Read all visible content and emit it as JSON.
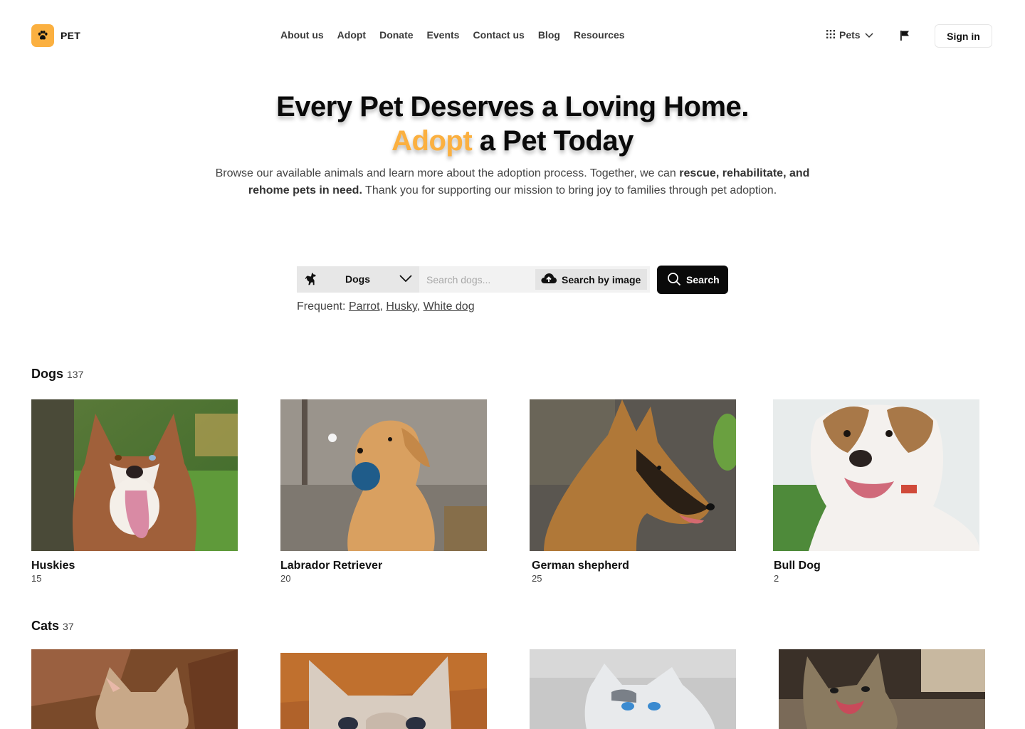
{
  "brand": {
    "name": "PET",
    "icon": "paw-icon",
    "accent_color": "#fbb040"
  },
  "nav": {
    "links": [
      "About us",
      "Adopt",
      "Donate",
      "Events",
      "Contact us",
      "Blog",
      "Resources"
    ],
    "pets_menu_label": "Pets",
    "sign_in_label": "Sign in"
  },
  "hero": {
    "title_line1": "Every Pet Deserves a Loving Home.",
    "title_accent": "Adopt",
    "title_line2_rest": " a Pet Today",
    "subtitle_pre": "Browse our available animals and learn more about the adoption process. Together, we can ",
    "subtitle_bold": "rescue, rehabilitate, and rehome pets in need.",
    "subtitle_post": " Thank you for supporting our mission to bring joy to families through pet adoption."
  },
  "search": {
    "species_selected": "Dogs",
    "placeholder": "Search dogs...",
    "image_search_label": "Search by image",
    "button_label": "Search",
    "frequent_label": "Frequent:",
    "frequent_terms": [
      "Parrot",
      "Husky",
      "White dog"
    ]
  },
  "sections": {
    "dogs": {
      "title": "Dogs",
      "count": "137",
      "cards": [
        {
          "name": "Huskies",
          "count": "15"
        },
        {
          "name": "Labrador Retriever",
          "count": "20"
        },
        {
          "name": "German shepherd",
          "count": "25"
        },
        {
          "name": "Bull Dog",
          "count": "2"
        }
      ]
    },
    "cats": {
      "title": "Cats",
      "count": "37"
    }
  }
}
